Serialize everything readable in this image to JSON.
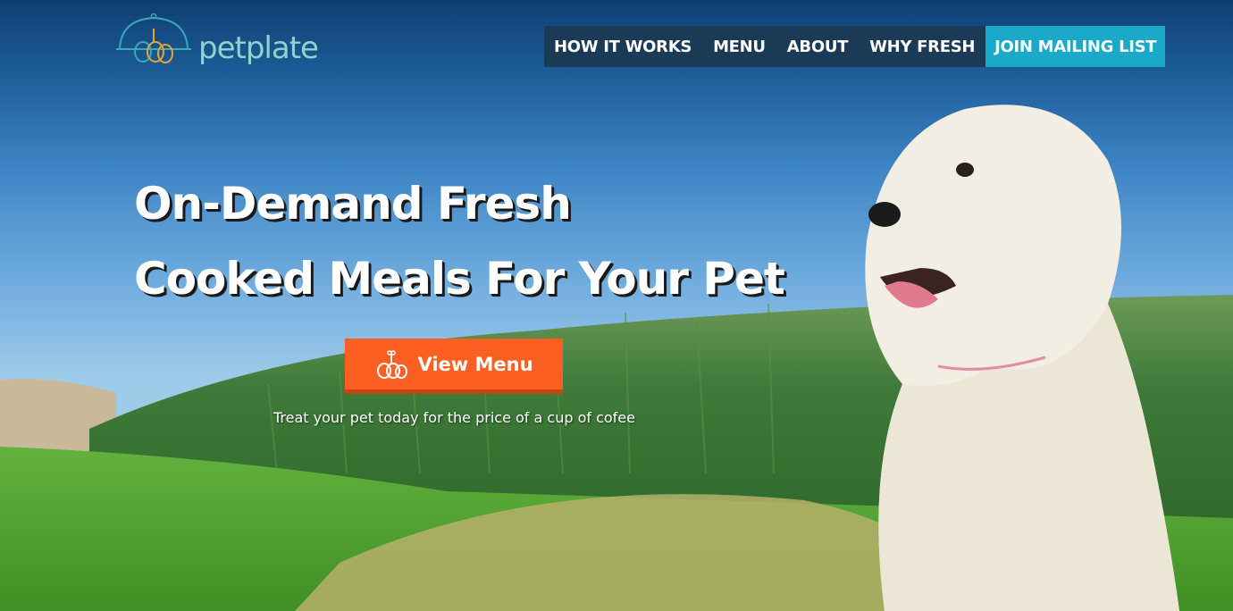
{
  "brand": {
    "name": "petplate"
  },
  "nav": {
    "items": [
      {
        "label": "HOW IT WORKS"
      },
      {
        "label": "MENU"
      },
      {
        "label": "ABOUT"
      },
      {
        "label": "WHY FRESH"
      }
    ],
    "cta_label": "JOIN MAILING LIST"
  },
  "hero": {
    "headline_line1": "On-Demand Fresh",
    "headline_line2": "Cooked Meals For Your Pet",
    "button_label": "View Menu",
    "button_icon": "food-bowl-icon",
    "tagline": "Treat your pet today for the price of a cup of cofee"
  },
  "colors": {
    "nav_bg": "#1a3a55",
    "nav_cta_bg": "#1aa9c8",
    "button_bg": "#fd5e21",
    "logo_text": "#8fd3cc"
  }
}
